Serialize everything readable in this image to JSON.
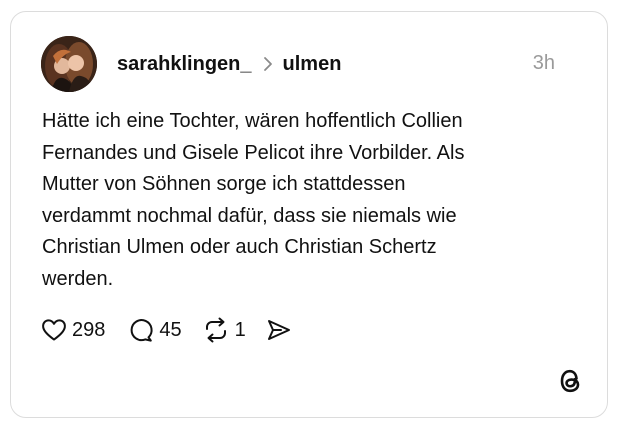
{
  "post": {
    "username": "sarahklingen_",
    "separator_icon": "chevron-right-icon",
    "channel": "ulmen",
    "timestamp": "3h",
    "text_lines": [
      "Hätte ich eine Tochter, wären  hoffentlich Collien",
      "Fernandes und Gisele Pelicot ihre Vorbilder. Als",
      "Mutter von Söhnen sorge ich stattdessen",
      "verdammt nochmal dafür, dass sie niemals wie",
      "Christian Ulmen oder auch Christian Schertz",
      "werden."
    ]
  },
  "actions": {
    "likes": "298",
    "comments": "45",
    "reposts": "1"
  },
  "icons": {
    "like": "heart-icon",
    "comment": "comment-bubble-icon",
    "repost": "repost-icon",
    "share": "send-icon",
    "brand": "threads-logo-icon"
  },
  "colors": {
    "text": "#111111",
    "timestamp": "#9a9a9a",
    "card_border": "#dcdcdc"
  }
}
